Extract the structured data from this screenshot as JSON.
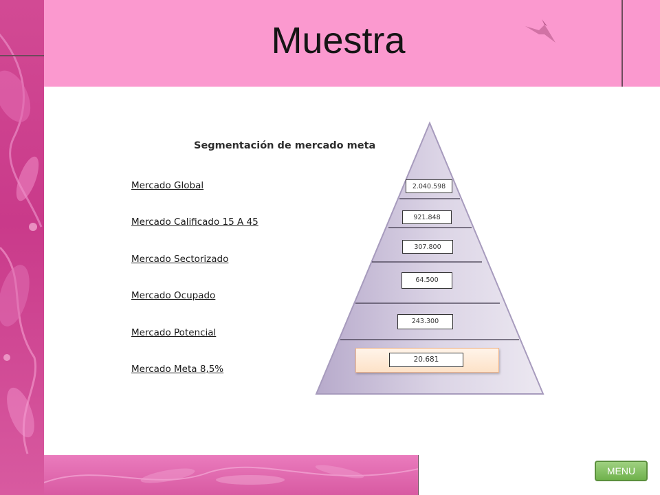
{
  "slide": {
    "title": "Muestra",
    "menu_label": "MENU"
  },
  "segmentation": {
    "title": "Segmentación de mercado meta",
    "rows": [
      {
        "label": "Mercado Global",
        "value": "2.040.598"
      },
      {
        "label": "Mercado Calificado 15 A 45",
        "value": "921.848"
      },
      {
        "label": "Mercado Sectorizado",
        "value": "307.800"
      },
      {
        "label": "Mercado Ocupado",
        "value": "64.500"
      },
      {
        "label": "Mercado Potencial",
        "value": "243.300"
      },
      {
        "label": "Mercado Meta 8,5%",
        "value": "20.681"
      }
    ]
  },
  "colors": {
    "header_pink": "#fb99cf",
    "side_magenta": "#c93a8a",
    "menu_green": "#6fb14c",
    "pyramid_lavender": "#c8bdd8"
  },
  "icons": {
    "hummingbird": "hummingbird-icon"
  }
}
